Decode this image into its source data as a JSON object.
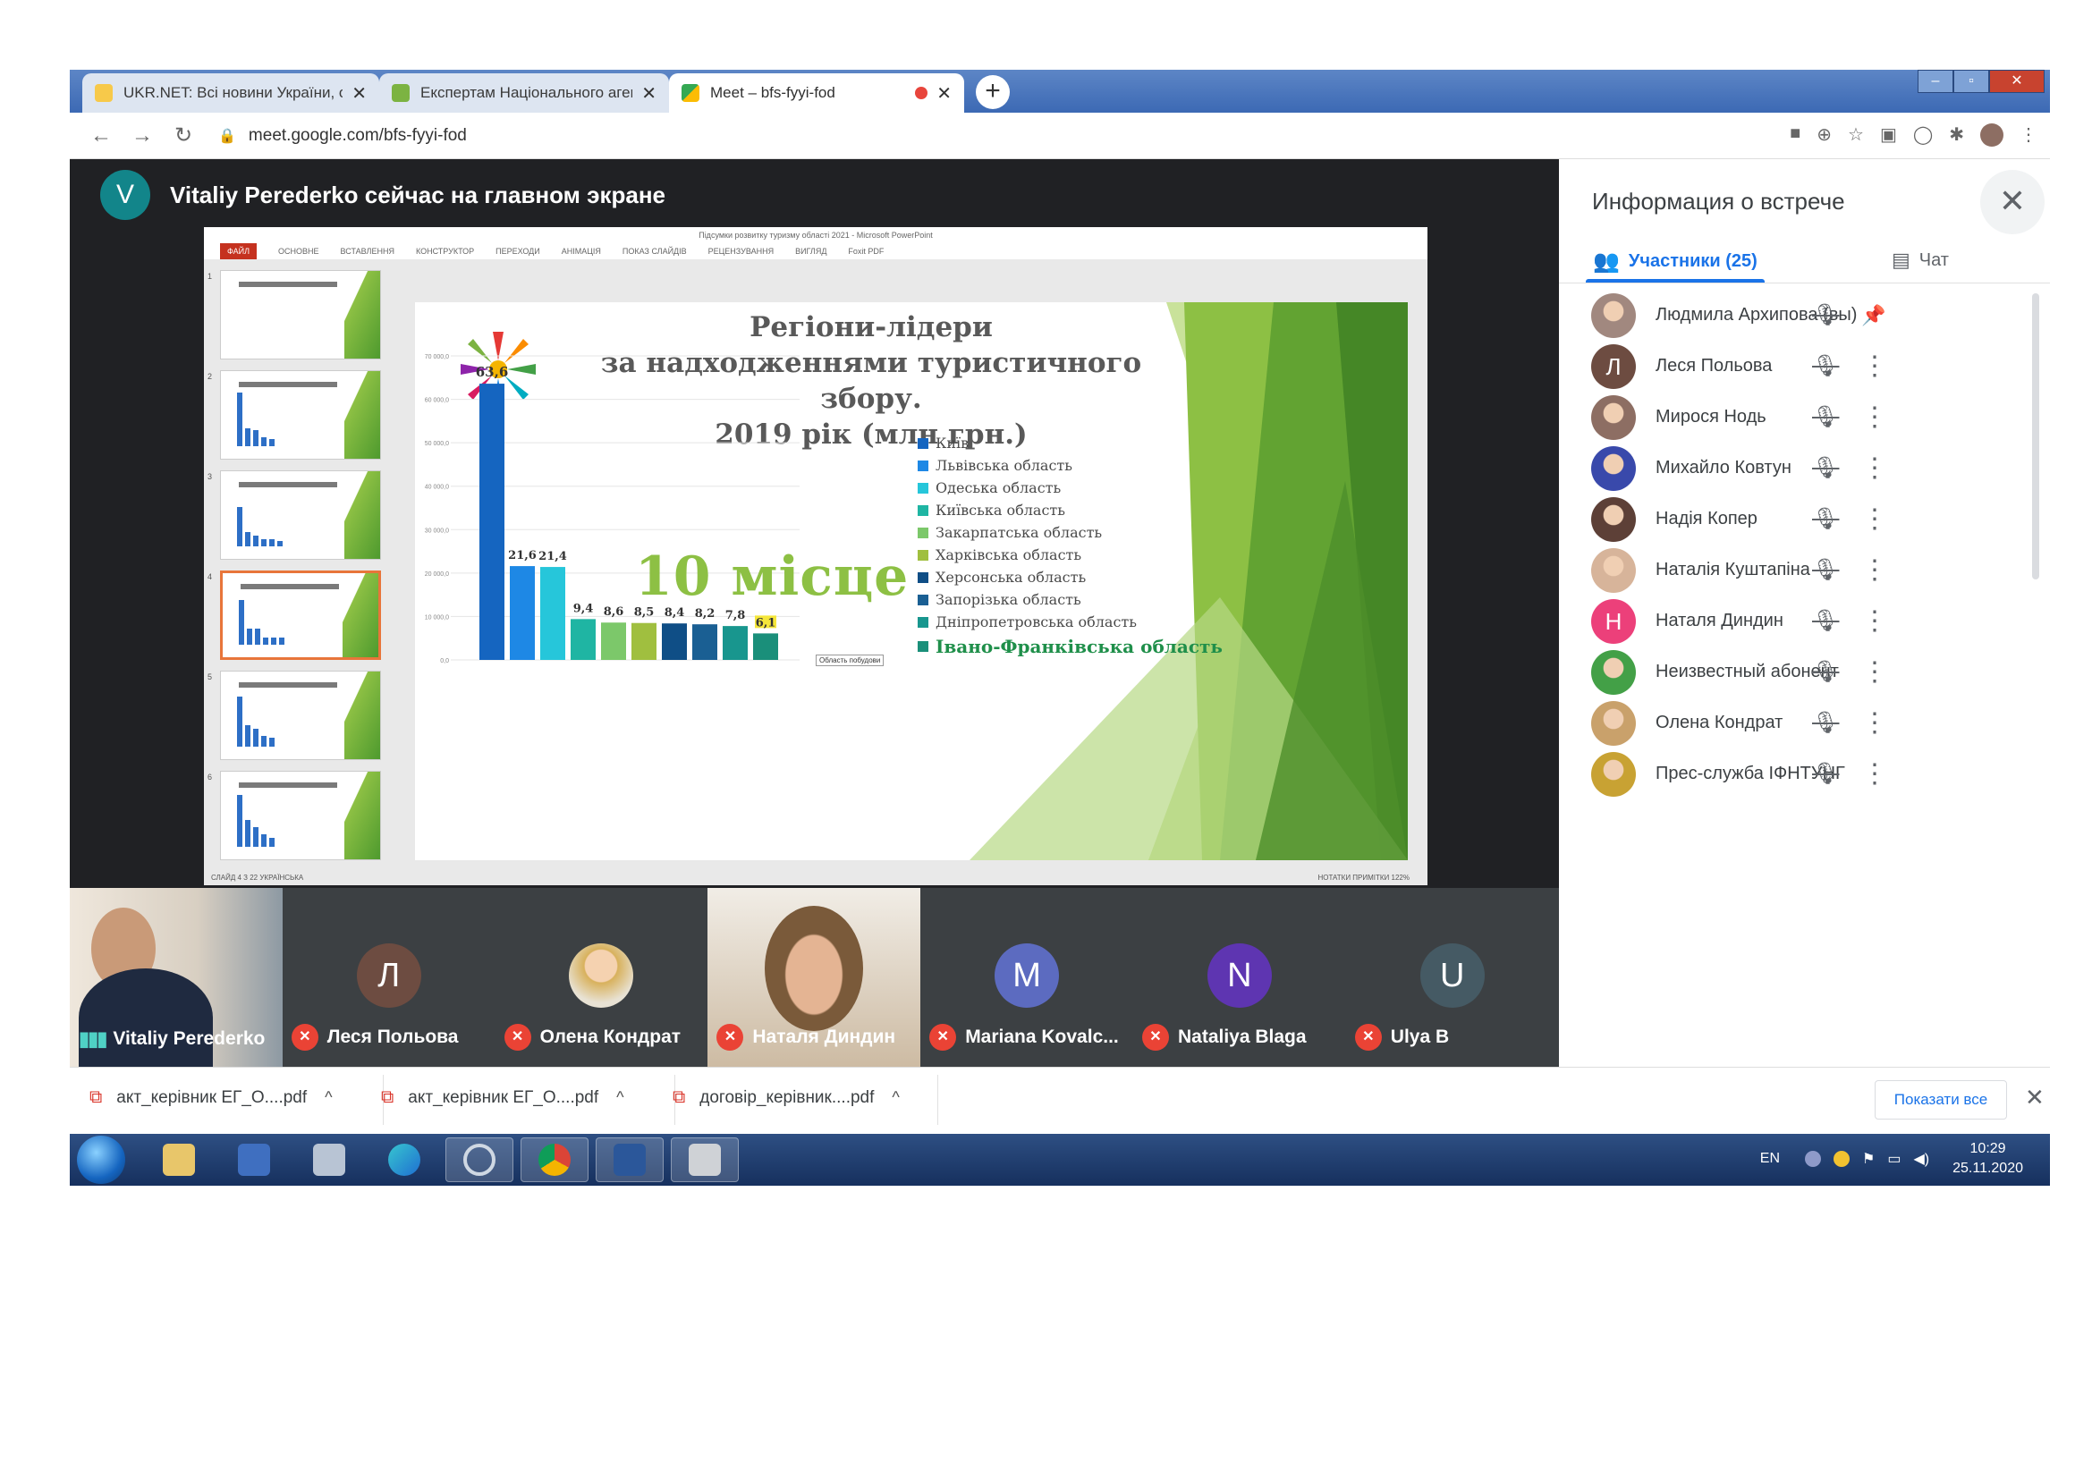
{
  "browser": {
    "tabs": [
      {
        "title": "UKR.NET: Всі новини України, о",
        "close": "✕"
      },
      {
        "title": "Експертам Національного агент",
        "close": "✕"
      },
      {
        "title": "Meet – bfs-fyyi-fod",
        "close": "✕"
      }
    ],
    "new_tab": "+",
    "url": "meet.google.com/bfs-fyyi-fod"
  },
  "meet": {
    "presenter_avatar": "V",
    "presenter_text": "Vitaliy Perederko сейчас на главном экране"
  },
  "powerpoint": {
    "window_title": "Підсумки розвитку туризму області 2021 - Microsoft PowerPoint",
    "ribbon": [
      "ФАЙЛ",
      "ОСНОВНЕ",
      "ВСТАВЛЕННЯ",
      "КОНСТРУКТОР",
      "ПЕРЕХОДИ",
      "АНІМАЦІЯ",
      "ПОКАЗ СЛАЙДІВ",
      "РЕЦЕНЗУВАННЯ",
      "ВИГЛЯД",
      "Foxit PDF"
    ],
    "thumb_numbers": [
      "1",
      "2",
      "3",
      "4",
      "5",
      "6"
    ],
    "status_left": "СЛАЙД 4 З 22   УКРАЇНСЬКА",
    "status_right": "НОТАТКИ   ПРИМІТКИ   122%",
    "tooltip": "Область побудови"
  },
  "slide": {
    "title": "Регіони-лідери за надходженнями туристичного збору. 2019 рік (млн грн.)",
    "title_lines": [
      "Регіони-лідери",
      "за надходженнями туристичного збору.",
      "2019 рік (млн грн.)"
    ],
    "highlight": "10 місце",
    "chart_data": {
      "type": "bar",
      "title": "Регіони-лідери за надходженнями туристичного збору. 2019 рік (млн грн.)",
      "categories": [
        "Київ",
        "Львівська область",
        "Одеська область",
        "Київська область",
        "Закарпатська область",
        "Харківська область",
        "Херсонська область",
        "Запорізька область",
        "Дніпропетровська область",
        "Івано-Франківська область"
      ],
      "values": [
        63.6,
        21.6,
        21.4,
        9.4,
        8.6,
        8.5,
        8.4,
        8.2,
        7.8,
        6.1
      ],
      "value_labels": [
        "63,6",
        "21,6",
        "21,4",
        "9,4",
        "8,6",
        "8,5",
        "8,4",
        "8,2",
        "7,8",
        "6,1"
      ],
      "colors": [
        "#1565c0",
        "#1e88e5",
        "#26c6da",
        "#1fb5a3",
        "#7cc86a",
        "#a0bf3f",
        "#0f4e86",
        "#1a5f93",
        "#18968e",
        "#1a8f7a"
      ],
      "ylim": [
        0,
        70
      ],
      "yticks": [
        "0,0",
        "10 000,0",
        "20 000,0",
        "30 000,0",
        "40 000,0",
        "50 000,0",
        "60 000,0",
        "70 000,0"
      ],
      "legend_position": "right",
      "highlighted_category": "Івано-Франківська область"
    }
  },
  "participants_tiles": [
    {
      "name": "Vitaliy Perederko",
      "type": "video-man",
      "speaking": true
    },
    {
      "name": "Леся Польова",
      "type": "avatar",
      "letter": "Л",
      "color": "#6d4c41"
    },
    {
      "name": "Олена Кондрат",
      "type": "photo-avatar",
      "color": "#c9a16b"
    },
    {
      "name": "Наталя Диндин",
      "type": "video-woman"
    },
    {
      "name": "Mariana Kovalc...",
      "type": "avatar",
      "letter": "M",
      "color": "#5c6bc0"
    },
    {
      "name": "Nataliya Blaga",
      "type": "avatar",
      "letter": "N",
      "color": "#5e35b1"
    },
    {
      "name": "Ulya B",
      "type": "avatar",
      "letter": "U",
      "color": "#455a64"
    }
  ],
  "panel": {
    "title": "Информация о встрече",
    "close": "✕",
    "tab_people": "Участники (25)",
    "tab_chat": "Чат",
    "participants": [
      {
        "name": "Людмила Архипова (вы)",
        "color": "#a1887f",
        "letter": "",
        "pin": true
      },
      {
        "name": "Леся Польова",
        "color": "#6d4c41",
        "letter": "Л"
      },
      {
        "name": "Мирося Нодь",
        "color": "#8d6e63",
        "letter": ""
      },
      {
        "name": "Михайло Ковтун",
        "color": "#3949ab",
        "letter": ""
      },
      {
        "name": "Надія Копер",
        "color": "#5d4037",
        "letter": ""
      },
      {
        "name": "Наталія Куштапіна",
        "color": "#d7b49a",
        "letter": ""
      },
      {
        "name": "Наталя Диндин",
        "color": "#ec407a",
        "letter": "Н"
      },
      {
        "name": "Неизвестный абонент",
        "color": "#43a047",
        "letter": ""
      },
      {
        "name": "Олена Кондрат",
        "color": "#c9a16b",
        "letter": ""
      },
      {
        "name": "Прес-служба ІФНТУНГ",
        "color": "#c8a233",
        "letter": ""
      }
    ]
  },
  "downloads": {
    "items": [
      "акт_керівник ЕГ_О....pdf",
      "акт_керівник ЕГ_О....pdf",
      "договір_керівник....pdf"
    ],
    "show_all": "Показати все",
    "close": "✕"
  },
  "taskbar": {
    "lang": "EN",
    "time": "10:29",
    "date": "25.11.2020"
  }
}
